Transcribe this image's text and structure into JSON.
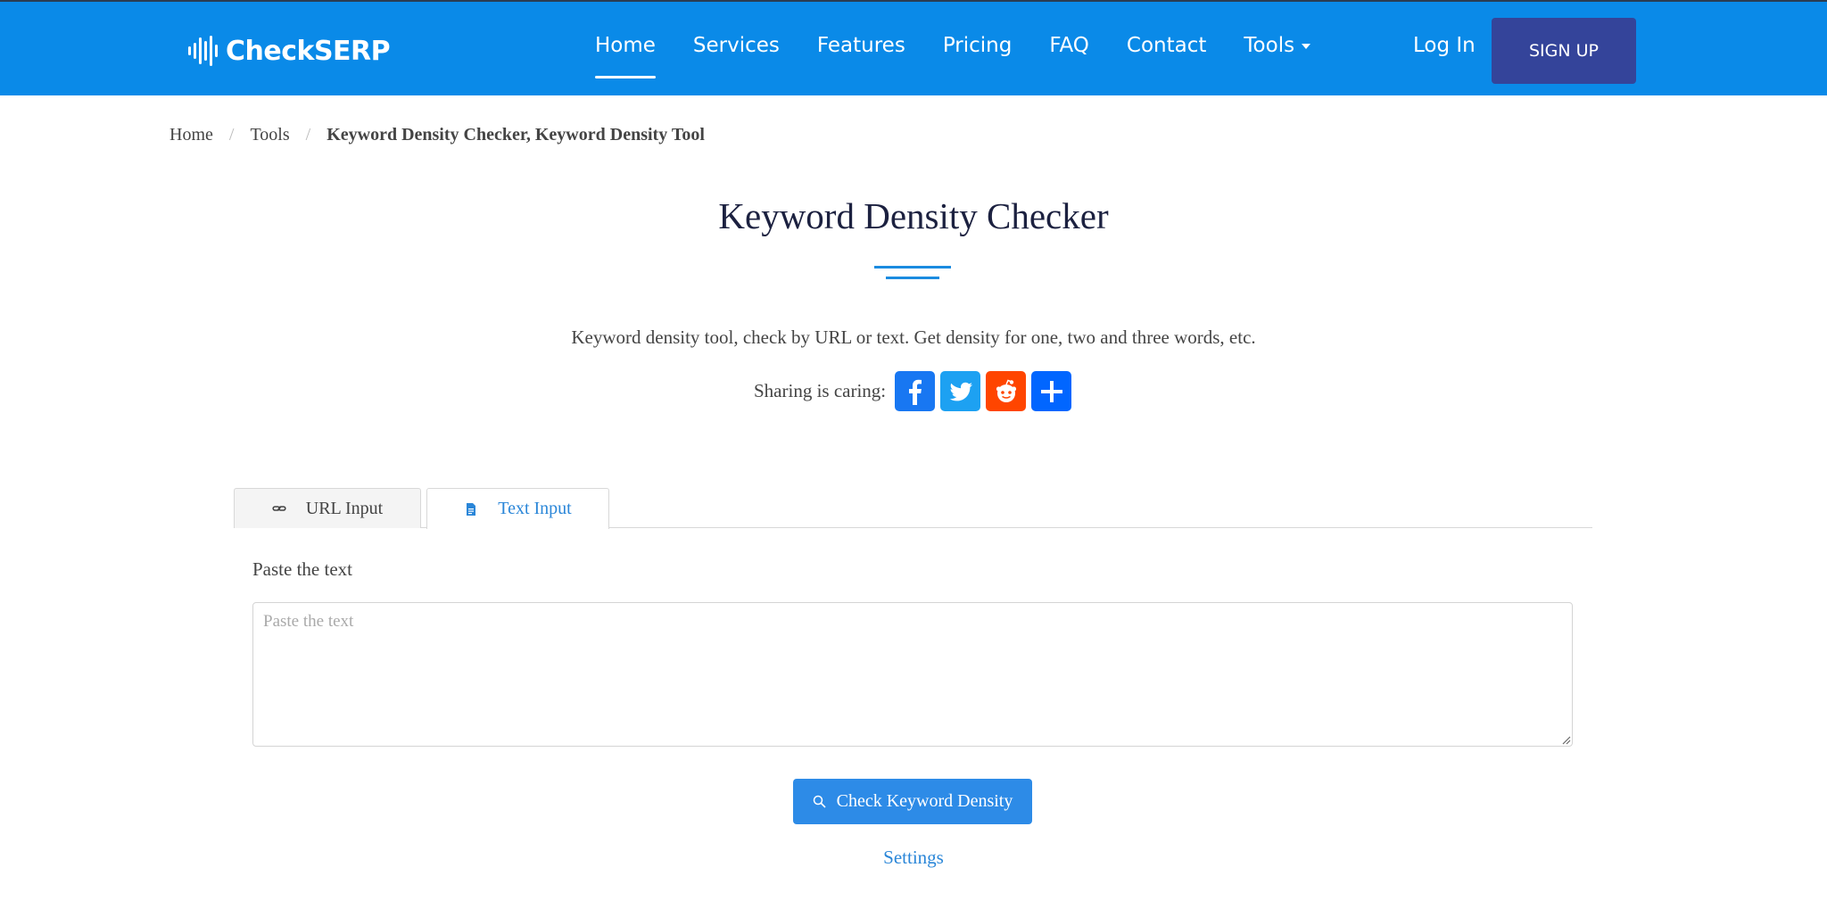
{
  "header": {
    "logo_text": "CheckSERP",
    "nav": [
      {
        "label": "Home",
        "active": true
      },
      {
        "label": "Services"
      },
      {
        "label": "Features"
      },
      {
        "label": "Pricing"
      },
      {
        "label": "FAQ"
      },
      {
        "label": "Contact"
      },
      {
        "label": "Tools"
      }
    ],
    "login_label": "Log In",
    "signup_label": "SIGN UP"
  },
  "breadcrumb": {
    "items": [
      "Home",
      "Tools",
      "Keyword Density Checker, Keyword Density Tool"
    ],
    "separator": "/"
  },
  "page": {
    "title": "Keyword Density Checker",
    "subtitle": "Keyword density tool, check by URL or text. Get density for one, two and three words, etc.",
    "share_label": "Sharing is caring:"
  },
  "tabs": [
    {
      "label": "URL Input",
      "icon": "link-icon"
    },
    {
      "label": "Text Input",
      "icon": "document-icon",
      "active": true
    }
  ],
  "form": {
    "label": "Paste the text",
    "placeholder": "Paste the text",
    "value": "",
    "submit_label": "Check Keyword Density",
    "settings_label": "Settings"
  },
  "colors": {
    "header_bg": "#0a8ae8",
    "signup_bg": "#34449a",
    "accent": "#2d8be7",
    "facebook": "#1877f2",
    "twitter": "#1da1f2",
    "reddit": "#ff4500",
    "share_more": "#0166ff"
  }
}
